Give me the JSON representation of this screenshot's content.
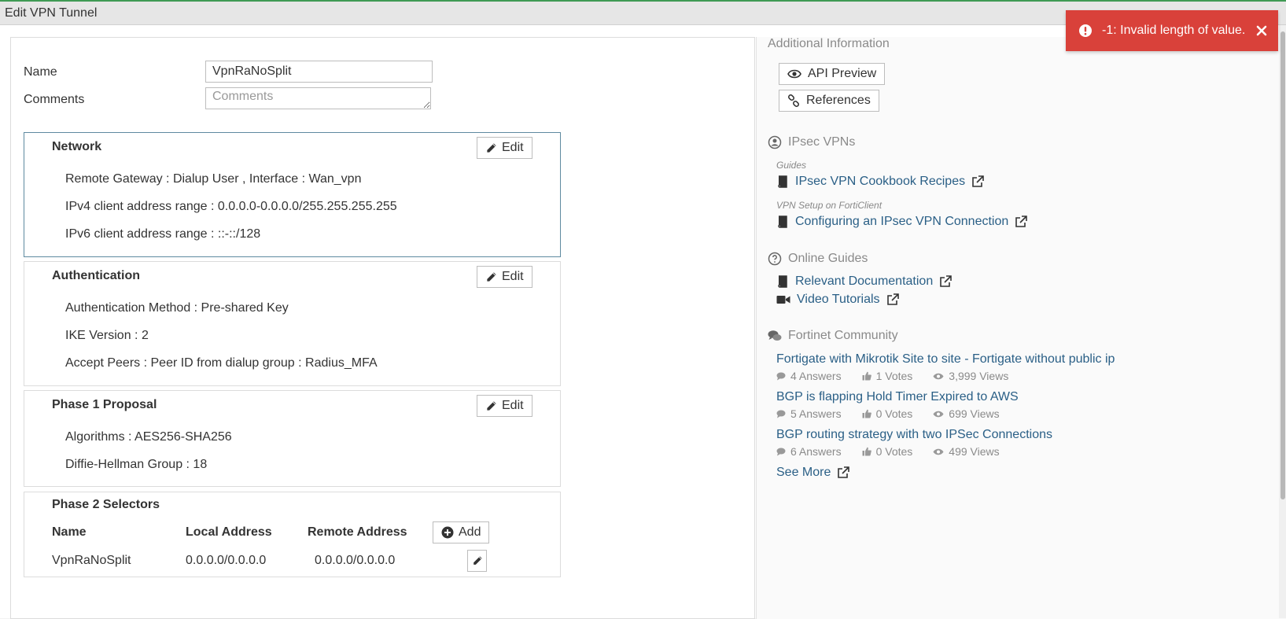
{
  "page": {
    "title": "Edit VPN Tunnel"
  },
  "form": {
    "name_label": "Name",
    "name_value": "VpnRaNoSplit",
    "comments_label": "Comments",
    "comments_placeholder": "Comments"
  },
  "sections": {
    "edit_label": "Edit",
    "network": {
      "title": "Network",
      "lines": [
        "Remote Gateway : Dialup User , Interface : Wan_vpn",
        "IPv4 client address range : 0.0.0.0-0.0.0.0/255.255.255.255",
        "IPv6 client address range : ::-::/128"
      ]
    },
    "authentication": {
      "title": "Authentication",
      "lines": [
        "Authentication Method : Pre-shared Key",
        "IKE Version : 2",
        "Accept Peers : Peer ID from dialup group : Radius_MFA"
      ]
    },
    "phase1": {
      "title": "Phase 1 Proposal",
      "lines": [
        "Algorithms : AES256-SHA256",
        "Diffie-Hellman Group : 18"
      ]
    },
    "phase2": {
      "title": "Phase 2 Selectors",
      "add_label": "Add",
      "columns": [
        "Name",
        "Local Address",
        "Remote Address"
      ],
      "rows": [
        {
          "name": "VpnRaNoSplit",
          "local": "0.0.0.0/0.0.0.0",
          "remote": "0.0.0.0/0.0.0.0"
        }
      ]
    }
  },
  "side": {
    "heading": "Additional Information",
    "api_preview_label": "API Preview",
    "references_label": "References",
    "ipsec": {
      "heading": "IPsec VPNs",
      "guides_label": "Guides",
      "cookbook_link": "IPsec VPN Cookbook Recipes",
      "forticlient_label": "VPN Setup on FortiClient",
      "configuring_link": "Configuring an IPsec VPN Connection"
    },
    "online_guides": {
      "heading": "Online Guides",
      "relevant_docs": "Relevant Documentation",
      "video_tutorials": "Video Tutorials"
    },
    "community": {
      "heading": "Fortinet Community",
      "posts": [
        {
          "title": "Fortigate with Mikrotik Site to site - Fortigate without public ip",
          "answers": "4 Answers",
          "votes": "1 Votes",
          "views": "3,999 Views"
        },
        {
          "title": "BGP is flapping Hold Timer Expired to AWS",
          "answers": "5 Answers",
          "votes": "0 Votes",
          "views": "699 Views"
        },
        {
          "title": "BGP routing strategy with two IPSec Connections",
          "answers": "6 Answers",
          "votes": "0 Votes",
          "views": "499 Views"
        }
      ],
      "see_more": "See More"
    }
  },
  "toast": {
    "message": "-1: Invalid length of value.",
    "color": "#d9413a"
  },
  "colors": {
    "link": "#2a5f86",
    "accent_green": "#3f9a54"
  },
  "icons": [
    "pencil-icon",
    "plus-circle-icon",
    "eye-icon",
    "link-icon",
    "book-icon",
    "external-link-icon",
    "video-icon",
    "question-icon",
    "comments-icon",
    "thumbs-up-icon",
    "exclamation-circle-icon",
    "close-icon",
    "ipsec-icon"
  ]
}
